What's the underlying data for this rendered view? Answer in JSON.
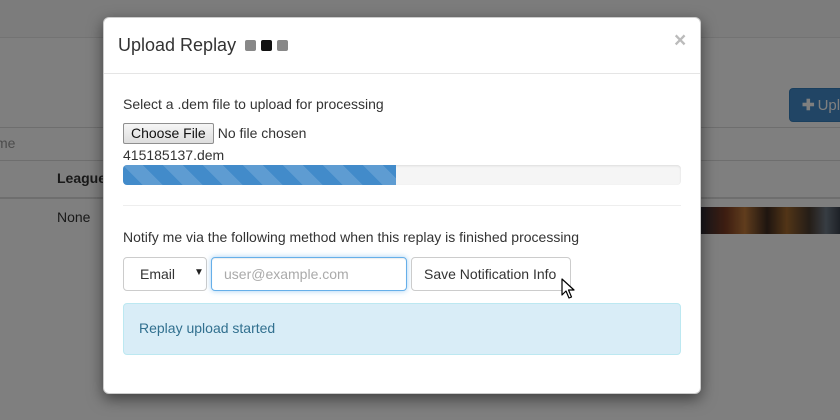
{
  "background": {
    "upload_button_label": "Upl",
    "filter_text": "me",
    "table_header_league": "League",
    "table_cell_league": "None"
  },
  "modal": {
    "title": "Upload Replay",
    "close_symbol": "×",
    "loading_indicator": {
      "dots": 3,
      "active_index": 1
    },
    "upload_section": {
      "instruction": "Select a .dem file to upload for processing",
      "choose_file_label": "Choose File",
      "no_file_text": "No file chosen",
      "file_name": "415185137.dem",
      "progress_percent": 49
    },
    "notify_section": {
      "instruction": "Notify me via the following method when this replay is finished processing",
      "method_selected": "Email",
      "email_placeholder": "user@example.com",
      "email_value": "",
      "save_label": "Save Notification Info"
    },
    "alert": {
      "message": "Replay upload started",
      "type": "info"
    }
  },
  "colors": {
    "primary": "#428bca",
    "alert_info_bg": "#d9edf7",
    "alert_info_text": "#31708f"
  }
}
